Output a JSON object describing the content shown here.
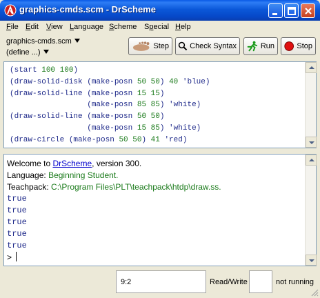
{
  "window": {
    "title": "graphics-cmds.scm - DrScheme",
    "controls": {
      "minimize": "minimize-icon",
      "maximize": "maximize-icon",
      "close": "close-icon"
    }
  },
  "menu": {
    "items": [
      {
        "label": "File",
        "mnemonic": "F",
        "rest": "ile"
      },
      {
        "label": "Edit",
        "mnemonic": "E",
        "rest": "dit"
      },
      {
        "label": "View",
        "mnemonic": "V",
        "rest": "iew"
      },
      {
        "label": "Language",
        "mnemonic": "L",
        "rest": "anguage"
      },
      {
        "label": "Scheme",
        "mnemonic": "S",
        "rest": "cheme"
      },
      {
        "label": "Special",
        "mnemonic": "p",
        "pre": "S",
        "rest": "ecial"
      },
      {
        "label": "Help",
        "mnemonic": "H",
        "rest": "elp"
      }
    ]
  },
  "toolbar": {
    "file_name": "graphics-cmds.scm",
    "define_menu": "(define ...)",
    "step_label": "Step",
    "check_syntax_label": "Check Syntax",
    "run_label": "Run",
    "stop_label": "Stop"
  },
  "definitions": {
    "lines": [
      [
        {
          "t": "(start ",
          "c": "p"
        },
        {
          "t": "100 100",
          "c": "n"
        },
        {
          "t": ")",
          "c": "p"
        }
      ],
      [
        {
          "t": "(draw-solid-disk (make-posn ",
          "c": "p"
        },
        {
          "t": "50 50",
          "c": "n"
        },
        {
          "t": ") ",
          "c": "p"
        },
        {
          "t": "40",
          "c": "n"
        },
        {
          "t": " 'blue)",
          "c": "p"
        }
      ],
      [
        {
          "t": "(draw-solid-line (make-posn ",
          "c": "p"
        },
        {
          "t": "15 15",
          "c": "n"
        },
        {
          "t": ")",
          "c": "p"
        }
      ],
      [
        {
          "t": "                 (make-posn ",
          "c": "p"
        },
        {
          "t": "85 85",
          "c": "n"
        },
        {
          "t": ") 'white)",
          "c": "p"
        }
      ],
      [
        {
          "t": "(draw-solid-line (make-posn ",
          "c": "p"
        },
        {
          "t": "50 50",
          "c": "n"
        },
        {
          "t": ")",
          "c": "p"
        }
      ],
      [
        {
          "t": "                 (make-posn ",
          "c": "p"
        },
        {
          "t": "15 85",
          "c": "n"
        },
        {
          "t": ") 'white)",
          "c": "p"
        }
      ],
      [
        {
          "t": "(draw-circle (make-posn ",
          "c": "p"
        },
        {
          "t": "50 50",
          "c": "n"
        },
        {
          "t": ") ",
          "c": "p"
        },
        {
          "t": "41",
          "c": "n"
        },
        {
          "t": " 'red)",
          "c": "p"
        }
      ]
    ]
  },
  "interactions": {
    "welcome_prefix": "Welcome to ",
    "welcome_link": "DrScheme",
    "welcome_suffix": ", version 300.",
    "language_prefix": "Language: ",
    "language_value": "Beginning Student.",
    "teachpack_prefix": "Teachpack: ",
    "teachpack_value": "C:\\Program Files\\PLT\\teachpack\\htdp\\draw.ss.",
    "outputs": [
      "true",
      "true",
      "true",
      "true",
      "true"
    ],
    "prompt": ">"
  },
  "status": {
    "position": "9:2",
    "mode": "Read/Write",
    "running": "not running"
  },
  "colors": {
    "paren_text": "#1f2a8a",
    "number_text": "#1a7a1a",
    "link": "#0000cc",
    "titlebar": "#0b58d9"
  }
}
